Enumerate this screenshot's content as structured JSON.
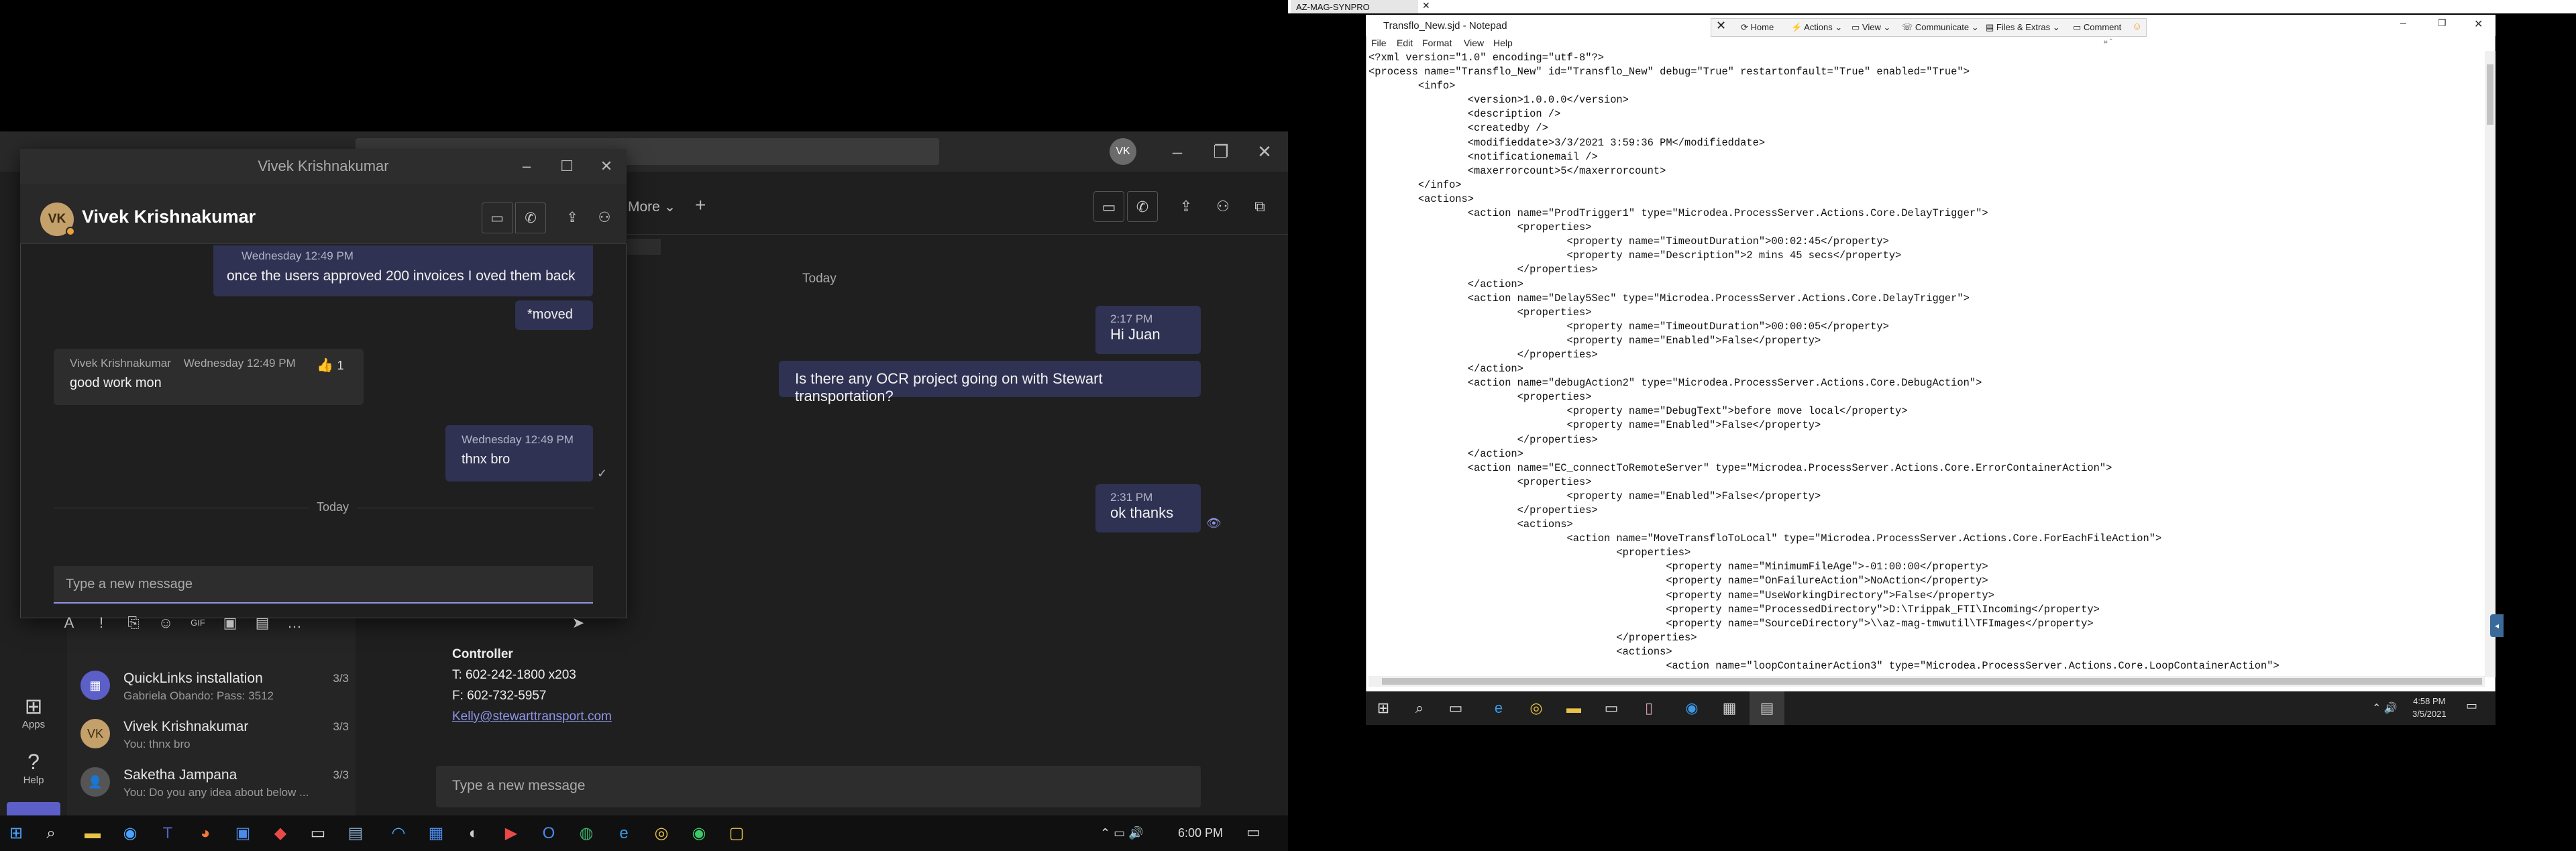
{
  "teams": {
    "rail": [
      {
        "label": "Apps",
        "icon": "apps-icon"
      },
      {
        "label": "Help",
        "icon": "help-icon"
      }
    ],
    "chat_list": [
      {
        "name": "QuickLinks installation",
        "sub": "Gabriela Obando: Pass: 3512",
        "date": "3/3",
        "avatar": ""
      },
      {
        "name": "Vivek Krishnakumar",
        "sub": "You: thnx bro",
        "date": "3/3",
        "avatar": "VK"
      },
      {
        "name": "Saketha Jampana",
        "sub": "You: Do you any idea about below ...",
        "date": "3/3",
        "avatar": ""
      }
    ],
    "header_more": "More",
    "main_messages": {
      "day_divider": "Today",
      "m1_time": "2:17 PM",
      "m1_text": "Hi Juan",
      "m2_text": "Is there any OCR project going on with Stewart transportation?",
      "m3_time": "2:31 PM",
      "m3_text": "ok thanks"
    },
    "contact_card": {
      "role": "Controller",
      "phone": "T: 602-242-1800 x203",
      "fax": "F: 602-732-5957",
      "email": "Kelly@stewarttransport.com"
    },
    "compose_placeholder": "Type a new message"
  },
  "popup": {
    "window_title": "Vivek Krishnakumar",
    "name": "Vivek Krishnakumar",
    "avatar": "VK",
    "messages": [
      {
        "meta": "Wednesday 12:49 PM",
        "text": "once the users approved 200 invoices I  oved them back"
      },
      {
        "text": "*moved"
      },
      {
        "sender": "Vivek Krishnakumar",
        "meta": "Wednesday 12:49 PM",
        "text": "good work mon",
        "reaction": "1"
      },
      {
        "meta": "Wednesday 12:49 PM",
        "text": "thnx bro"
      }
    ],
    "day_divider": "Today",
    "compose_placeholder": "Type a new message"
  },
  "left_taskbar": {
    "clock": "6:00 PM"
  },
  "remote": {
    "tab_title": "AZ-MAG-SYNPRO",
    "notepad_title": "Transflo_New.sjd - Notepad",
    "menu": [
      "File",
      "Edit",
      "Format",
      "View",
      "Help"
    ],
    "toolbar": [
      "Home",
      "Actions",
      "View",
      "Communicate",
      "Files & Extras",
      "Comment"
    ],
    "lines": [
      "<?xml version=\"1.0\" encoding=\"utf-8\"?>",
      "<process name=\"Transflo_New\" id=\"Transflo_New\" debug=\"True\" restartonfault=\"True\" enabled=\"True\">",
      "        <info>",
      "                <version>1.0.0.0</version>",
      "                <description />",
      "                <createdby />",
      "                <modifieddate>3/3/2021 3:59:36 PM</modifieddate>",
      "                <notificationemail />",
      "                <maxerrorcount>5</maxerrorcount>",
      "        </info>",
      "        <actions>",
      "                <action name=\"ProdTrigger1\" type=\"Microdea.ProcessServer.Actions.Core.DelayTrigger\">",
      "                        <properties>",
      "                                <property name=\"TimeoutDuration\">00:02:45</property>",
      "                                <property name=\"Description\">2 mins 45 secs</property>",
      "                        </properties>",
      "                </action>",
      "                <action name=\"Delay5Sec\" type=\"Microdea.ProcessServer.Actions.Core.DelayTrigger\">",
      "                        <properties>",
      "                                <property name=\"TimeoutDuration\">00:00:05</property>",
      "                                <property name=\"Enabled\">False</property>",
      "                        </properties>",
      "                </action>",
      "                <action name=\"debugAction2\" type=\"Microdea.ProcessServer.Actions.Core.DebugAction\">",
      "                        <properties>",
      "                                <property name=\"DebugText\">before move local</property>",
      "                                <property name=\"Enabled\">False</property>",
      "                        </properties>",
      "                </action>",
      "                <action name=\"EC_connectToRemoteServer\" type=\"Microdea.ProcessServer.Actions.Core.ErrorContainerAction\">",
      "                        <properties>",
      "                                <property name=\"Enabled\">False</property>",
      "                        </properties>",
      "                        <actions>",
      "                                <action name=\"MoveTransfloToLocal\" type=\"Microdea.ProcessServer.Actions.Core.ForEachFileAction\">",
      "                                        <properties>",
      "                                                <property name=\"MinimumFileAge\">-01:00:00</property>",
      "                                                <property name=\"OnFailureAction\">NoAction</property>",
      "                                                <property name=\"UseWorkingDirectory\">False</property>",
      "                                                <property name=\"ProcessedDirectory\">D:\\Trippak_FTI\\Incoming</property>",
      "                                                <property name=\"SourceDirectory\">\\\\az-mag-tmwutil\\TFImages</property>",
      "                                        </properties>",
      "                                        <actions>",
      "                                                <action name=\"loopContainerAction3\" type=\"Microdea.ProcessServer.Actions.Core.LoopContainerAction\">"
    ],
    "clock_time": "4:58 PM",
    "clock_date": "3/5/2021"
  },
  "colors": {
    "accent": "#8f95e8",
    "teams_bg": "#1f1f1f",
    "notepad_bg": "#ffffff"
  }
}
